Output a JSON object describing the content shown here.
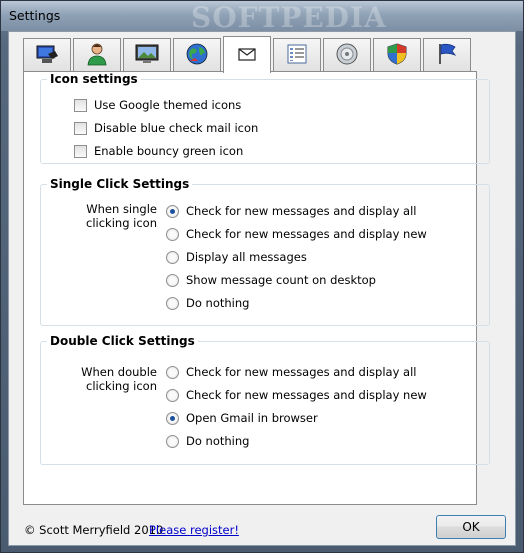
{
  "window": {
    "title": "Settings",
    "watermark": "SOFTPEDIA"
  },
  "tabs": [
    {
      "icon": "computer-icon"
    },
    {
      "icon": "user-icon"
    },
    {
      "icon": "screen-icon"
    },
    {
      "icon": "globe-icon"
    },
    {
      "icon": "mail-icon",
      "active": true
    },
    {
      "icon": "list-icon"
    },
    {
      "icon": "sound-icon"
    },
    {
      "icon": "shield-icon"
    },
    {
      "icon": "flag-icon"
    }
  ],
  "icon_settings": {
    "title": "Icon settings",
    "options": [
      {
        "label": "Use Google themed icons",
        "checked": false
      },
      {
        "label": "Disable blue check mail icon",
        "checked": false
      },
      {
        "label": "Enable bouncy green icon",
        "checked": false
      }
    ]
  },
  "single_click": {
    "title": "Single Click Settings",
    "question": "When single clicking icon",
    "options": [
      {
        "label": "Check for new messages and display all",
        "selected": true
      },
      {
        "label": "Check for new messages and display new",
        "selected": false
      },
      {
        "label": "Display all messages",
        "selected": false
      },
      {
        "label": "Show message count on desktop",
        "selected": false
      },
      {
        "label": "Do nothing",
        "selected": false
      }
    ]
  },
  "double_click": {
    "title": "Double Click Settings",
    "question": "When double clicking icon",
    "options": [
      {
        "label": "Check for new messages and display all",
        "selected": false
      },
      {
        "label": "Check for new messages and display new",
        "selected": false
      },
      {
        "label": "Open Gmail in browser",
        "selected": true
      },
      {
        "label": "Do nothing",
        "selected": false
      }
    ]
  },
  "footer": {
    "copyright": "© Scott Merryfield 2010",
    "register_link": "Please register!",
    "ok_label": "OK"
  }
}
